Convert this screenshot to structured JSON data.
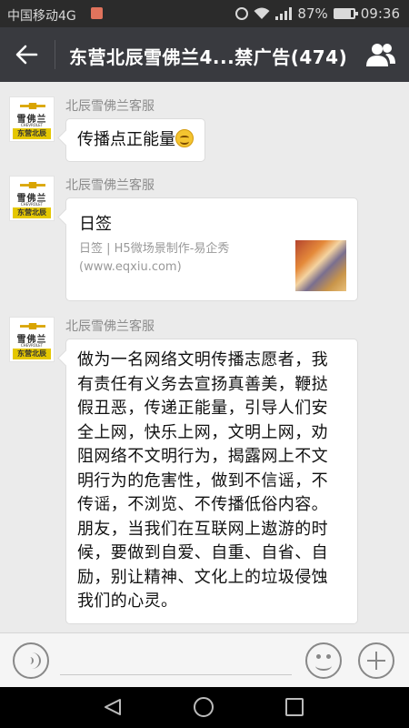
{
  "status_bar": {
    "carrier": "中国移动4G",
    "network": "4G",
    "battery": "87%",
    "battery_level": 0.87,
    "time": "09:36"
  },
  "header": {
    "title": "东营北辰雪佛兰4...禁广告(474)",
    "back_icon": "arrow-left-icon",
    "group_icon": "group-members-icon"
  },
  "avatar": {
    "brand_line1": "雪佛兰",
    "brand_line2": "CHEVROLET",
    "brand_line3": "东营北辰"
  },
  "messages": [
    {
      "sender": "北辰雪佛兰客服",
      "type": "text",
      "text": "传播点正能量"
    },
    {
      "sender": "北辰雪佛兰客服",
      "type": "link",
      "link_title": "日签",
      "link_desc_line1": "日签 | H5微场景制作-易企秀",
      "link_desc_line2": "(www.eqxiu.com)"
    },
    {
      "sender": "北辰雪佛兰客服",
      "type": "text",
      "lines": [
        "做为一名网络文明传播志愿者，我",
        "有责任有义务去宣扬真善美，鞭挞",
        "假丑恶，传递正能量，引导人们安",
        "全上网，快乐上网，文明上网，劝",
        "阻网络不文明行为，揭露网上不文",
        "明行为的危害性，做到不信谣，不",
        "传谣，不浏览、不传播低俗内容。",
        "朋友，当我们在互联网上遨游的时",
        "候，要做到自爱、自重、自省、自",
        "励，别让精神、文化上的垃圾侵蚀",
        "我们的心灵。"
      ]
    }
  ],
  "input_bar": {
    "voice_icon": "voice-icon",
    "emoji_icon": "emoji-icon",
    "plus_icon": "plus-icon"
  },
  "nav_bar": {
    "back_icon": "triangle-back-icon",
    "home_icon": "circle-home-icon",
    "recent_icon": "square-recent-icon"
  }
}
